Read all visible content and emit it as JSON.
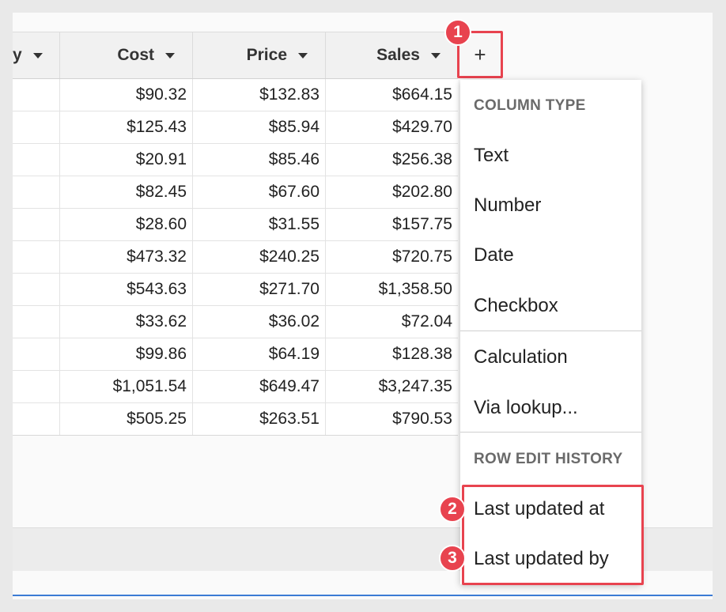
{
  "table": {
    "columns": [
      {
        "label": "y"
      },
      {
        "label": "Cost"
      },
      {
        "label": "Price"
      },
      {
        "label": "Sales"
      }
    ],
    "rows": [
      [
        "$90.32",
        "$132.83",
        "$664.15"
      ],
      [
        "$125.43",
        "$85.94",
        "$429.70"
      ],
      [
        "$20.91",
        "$85.46",
        "$256.38"
      ],
      [
        "$82.45",
        "$67.60",
        "$202.80"
      ],
      [
        "$28.60",
        "$31.55",
        "$157.75"
      ],
      [
        "$473.32",
        "$240.25",
        "$720.75"
      ],
      [
        "$543.63",
        "$271.70",
        "$1,358.50"
      ],
      [
        "$33.62",
        "$36.02",
        "$72.04"
      ],
      [
        "$99.86",
        "$64.19",
        "$128.38"
      ],
      [
        "$1,051.54",
        "$649.47",
        "$3,247.35"
      ],
      [
        "$505.25",
        "$263.51",
        "$790.53"
      ]
    ]
  },
  "add_column": {
    "label": "+"
  },
  "menu": {
    "section_column_type": "COLUMN TYPE",
    "items_type": [
      "Text",
      "Number",
      "Date",
      "Checkbox"
    ],
    "items_calc": [
      "Calculation",
      "Via lookup..."
    ],
    "section_history": "ROW EDIT HISTORY",
    "items_history": [
      "Last updated at",
      "Last updated by"
    ]
  },
  "badges": [
    "1",
    "2",
    "3"
  ],
  "colors": {
    "accent": "#e8434f",
    "bottom_line": "#3b7bd4"
  }
}
